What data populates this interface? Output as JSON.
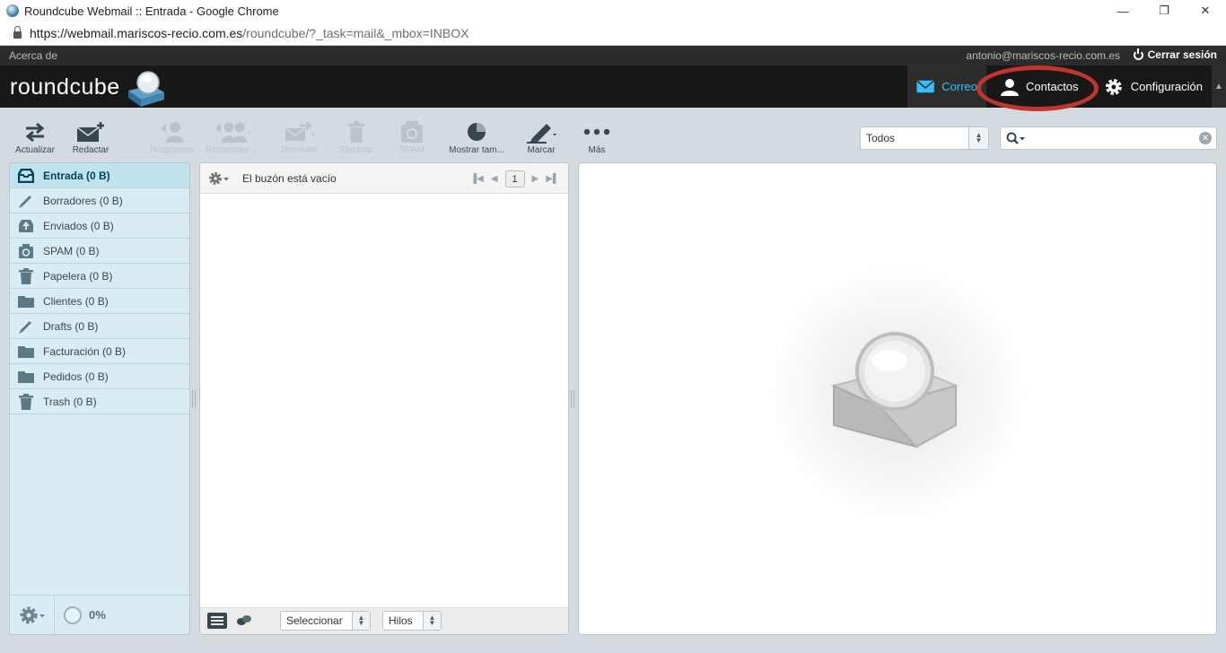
{
  "window": {
    "title": "Roundcube Webmail :: Entrada - Google Chrome",
    "url_host": "https://webmail.mariscos-recio.com.es",
    "url_path": "/roundcube/?_task=mail&_mbox=INBOX"
  },
  "topline": {
    "about": "Acerca de",
    "user_email": "antonio@mariscos-recio.com.es",
    "logout": "Cerrar sesión"
  },
  "header": {
    "logo_text": "roundcube",
    "nav": {
      "mail": "Correo",
      "contacts": "Contactos",
      "settings": "Configuración"
    }
  },
  "toolbar": {
    "refresh": "Actualizar",
    "compose": "Redactar",
    "reply": "Responder",
    "reply_all": "Responder ...",
    "forward": "Reenviar",
    "delete": "Eliminar",
    "spam": "SPAM",
    "show_size": "Mostrar tam...",
    "mark": "Marcar",
    "more": "Más",
    "filter_value": "Todos"
  },
  "folders": [
    {
      "label": "Entrada (0 B)",
      "icon": "inbox-icon"
    },
    {
      "label": "Borradores (0 B)",
      "icon": "pencil-icon"
    },
    {
      "label": "Enviados (0 B)",
      "icon": "sent-icon"
    },
    {
      "label": "SPAM (0 B)",
      "icon": "spam-icon"
    },
    {
      "label": "Papelera (0 B)",
      "icon": "trash-icon"
    },
    {
      "label": "Clientes (0 B)",
      "icon": "folder-icon"
    },
    {
      "label": "Drafts (0 B)",
      "icon": "pencil-icon"
    },
    {
      "label": "Facturación (0 B)",
      "icon": "folder-icon"
    },
    {
      "label": "Pedidos (0 B)",
      "icon": "folder-icon"
    },
    {
      "label": "Trash (0 B)",
      "icon": "trash-icon"
    }
  ],
  "quota": {
    "value": "0%"
  },
  "messagelist": {
    "empty_text": "El buzón está vacío",
    "page": "1",
    "select_label": "Seleccionar",
    "threads_label": "Hilos"
  },
  "colors": {
    "accent": "#37beff",
    "highlight_ring": "#c1362c",
    "folder_bg": "#d9ecf4"
  }
}
